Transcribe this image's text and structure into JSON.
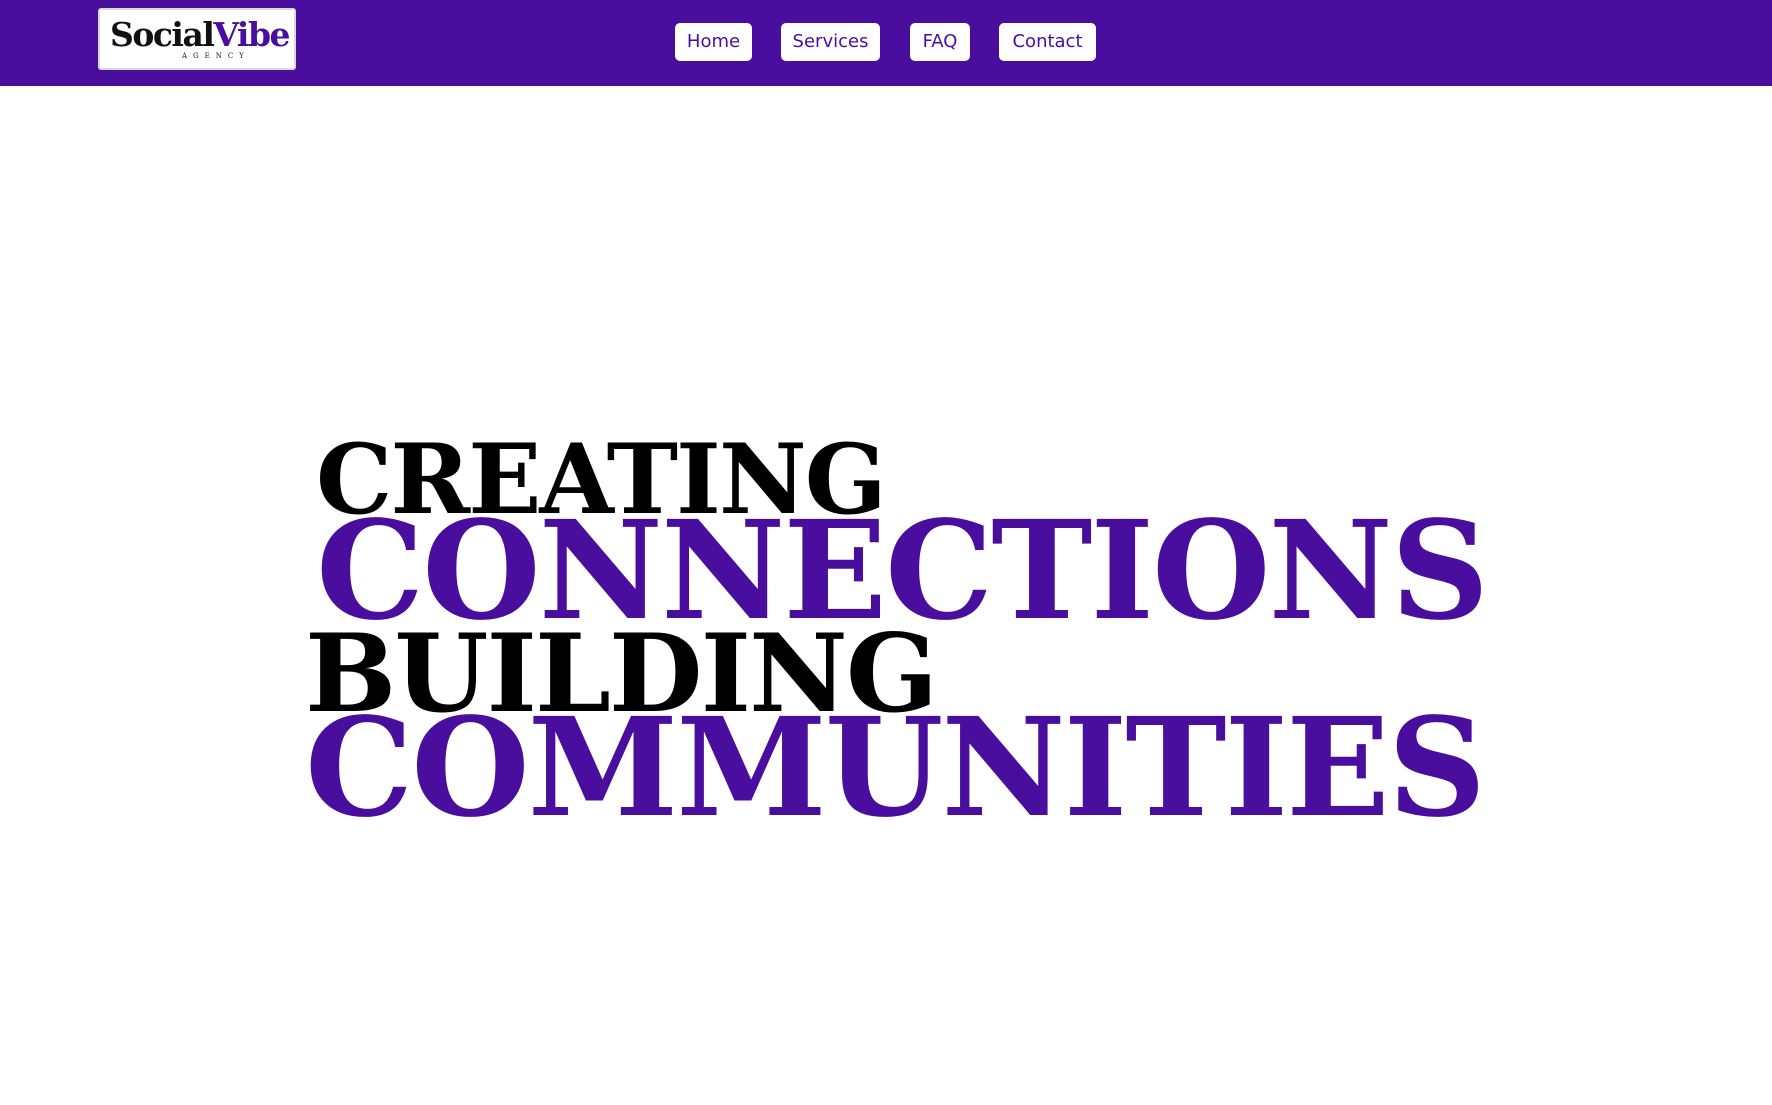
{
  "brand": {
    "logo_primary": "Social",
    "logo_accent": "Vibe",
    "logo_tagline": "AGENCY",
    "accent_color": "#4a0e9e"
  },
  "nav": {
    "items": [
      {
        "label": "Home"
      },
      {
        "label": "Services"
      },
      {
        "label": "FAQ"
      },
      {
        "label": "Contact"
      }
    ]
  },
  "hero": {
    "line1": "CREATING",
    "line2": "CONNECTIONS",
    "line3": "BUILDING",
    "line4": "COMMUNITIES"
  }
}
